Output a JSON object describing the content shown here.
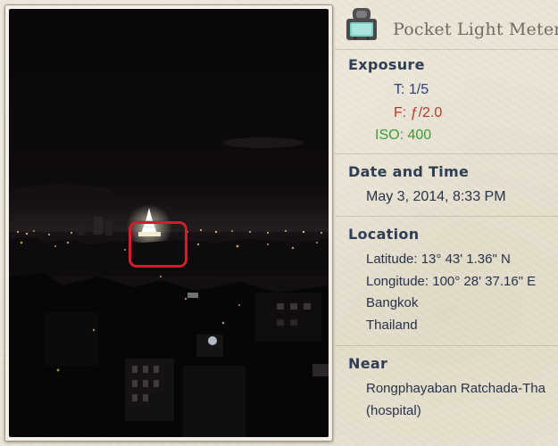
{
  "app": {
    "title": "Pocket Light Meter",
    "icon": "light-meter-icon"
  },
  "exposure": {
    "heading": "Exposure",
    "shutter": "T: 1/5",
    "aperture": "F: ƒ/2.0",
    "iso": "ISO: 400",
    "colors": {
      "shutter": "#2b3f7d",
      "aperture": "#b43a2c",
      "iso": "#3c9a33"
    }
  },
  "datetime": {
    "heading": "Date and Time",
    "value": "May 3, 2014, 8:33 PM"
  },
  "location": {
    "heading": "Location",
    "latitude": "Latitude: 13° 43' 1.36\" N",
    "longitude": "Longitude: 100° 28' 37.16\" E",
    "city": "Bangkok",
    "country": "Thailand"
  },
  "near": {
    "heading": "Near",
    "place": "Rongphayaban Ratchada-Tha",
    "type": "(hospital)"
  },
  "photo": {
    "subject": "night-cityscape-with-lit-pagoda",
    "focus_color": "#d21e2a"
  }
}
